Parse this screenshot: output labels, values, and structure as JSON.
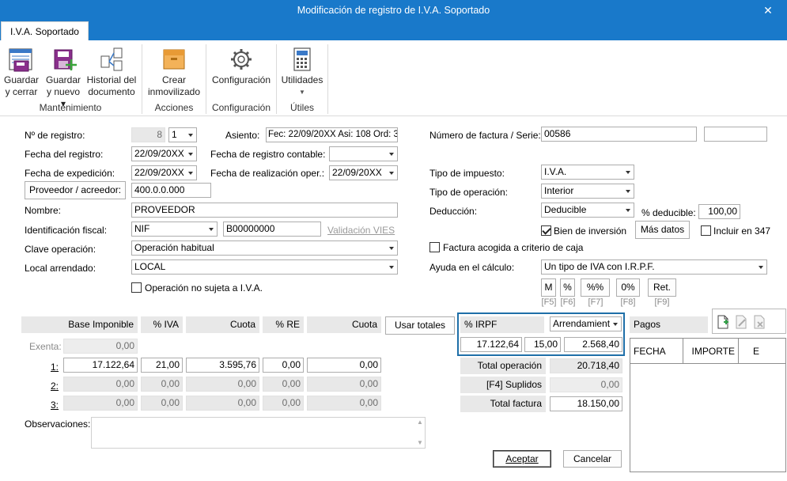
{
  "window": {
    "title": "Modificación de registro de I.V.A. Soportado",
    "close_glyph": "✕"
  },
  "ribbon": {
    "tab": "I.V.A. Soportado",
    "buttons": {
      "guardar_cerrar": "Guardar y cerrar",
      "guardar_nuevo": "Guardar y nuevo ▾",
      "historial": "Historial del documento",
      "crear_inmovilizado": "Crear inmovilizado",
      "configuracion": "Configuración",
      "utilidades": "Utilidades"
    },
    "groups": {
      "mantenimiento": "Mantenimiento",
      "acciones": "Acciones",
      "configuracion": "Configuración",
      "utiles": "Útiles"
    }
  },
  "form": {
    "registro": {
      "label": "Nº de registro:",
      "value": "8",
      "serie": "1"
    },
    "asiento": {
      "label": "Asiento:",
      "value": "Fec: 22/09/20XX Asi: 108 Ord: 3"
    },
    "fecha_registro": {
      "label": "Fecha del registro:",
      "value": "22/09/20XX"
    },
    "fecha_contable": {
      "label": "Fecha de registro contable:",
      "value": ""
    },
    "fecha_expedicion": {
      "label": "Fecha de expedición:",
      "value": "22/09/20XX"
    },
    "fecha_realizacion": {
      "label": "Fecha de realización oper.:",
      "value": "22/09/20XX"
    },
    "proveedor": {
      "button": "Proveedor / acreedor:",
      "value": "400.0.0.000"
    },
    "nombre": {
      "label": "Nombre:",
      "value": "PROVEEDOR"
    },
    "identificacion": {
      "label": "Identificación fiscal:",
      "type": "NIF",
      "value": "B00000000",
      "vies": "Validación VIES"
    },
    "clave_operacion": {
      "label": "Clave operación:",
      "value": "Operación habitual"
    },
    "local_arrendado": {
      "label": "Local arrendado:",
      "value": "LOCAL"
    },
    "no_sujeta": "Operación no sujeta a I.V.A.",
    "factura": {
      "label": "Número de factura / Serie:",
      "value": "00586",
      "serie": ""
    },
    "tipo_impuesto": {
      "label": "Tipo de impuesto:",
      "value": "I.V.A."
    },
    "tipo_operacion": {
      "label": "Tipo de operación:",
      "value": "Interior"
    },
    "deduccion": {
      "label": "Deducción:",
      "value": "Deducible",
      "pct_label": "% deducible:",
      "pct_value": "100,00"
    },
    "bien_inversion": "Bien de inversión",
    "mas_datos": "Más datos",
    "incluir_347": "Incluir en 347",
    "criterio_caja": "Factura acogida a criterio de caja",
    "ayuda": {
      "label": "Ayuda en el cálculo:",
      "value": "Un tipo de IVA con I.R.P.F."
    },
    "fbuttons": [
      {
        "label": "M",
        "key": "[F5]"
      },
      {
        "label": "%",
        "key": "[F6]"
      },
      {
        "label": "%%",
        "key": "[F7]"
      },
      {
        "label": "0%",
        "key": "[F8]"
      },
      {
        "label": "Ret.",
        "key": "[F9]"
      }
    ]
  },
  "grid": {
    "headers": {
      "base": "Base Imponible",
      "iva": "% IVA",
      "cuota": "Cuota",
      "re": "% RE",
      "cuota_re": "Cuota"
    },
    "usar_totales": "Usar totales",
    "exenta": {
      "label": "Exenta:",
      "value": "0,00"
    },
    "rows": [
      {
        "label": "1:",
        "base": "17.122,64",
        "iva": "21,00",
        "cuota": "3.595,76",
        "re": "0,00",
        "cuota_re": "0,00"
      },
      {
        "label": "2:",
        "base": "0,00",
        "iva": "0,00",
        "cuota": "0,00",
        "re": "0,00",
        "cuota_re": "0,00"
      },
      {
        "label": "3:",
        "base": "0,00",
        "iva": "0,00",
        "cuota": "0,00",
        "re": "0,00",
        "cuota_re": "0,00"
      }
    ],
    "observaciones": {
      "label": "Observaciones:",
      "value": ""
    }
  },
  "irpf": {
    "label": "% IRPF",
    "tipo": "Arrendamient",
    "base": "17.122,64",
    "pct": "15,00",
    "cuota": "2.568,40"
  },
  "totales": {
    "operacion": {
      "label": "Total operación",
      "value": "20.718,40"
    },
    "suplidos": {
      "label": "[F4] Suplidos",
      "value": "0,00"
    },
    "factura": {
      "label": "Total factura",
      "value": "18.150,00"
    }
  },
  "pagos": {
    "label": "Pagos",
    "columns": [
      "FECHA",
      "IMPORTE",
      "E"
    ]
  },
  "actions": {
    "aceptar": "Aceptar",
    "cancelar": "Cancelar"
  },
  "colors": {
    "titlebar": "#1979ca",
    "irpf_border": "#1f6fa8"
  }
}
